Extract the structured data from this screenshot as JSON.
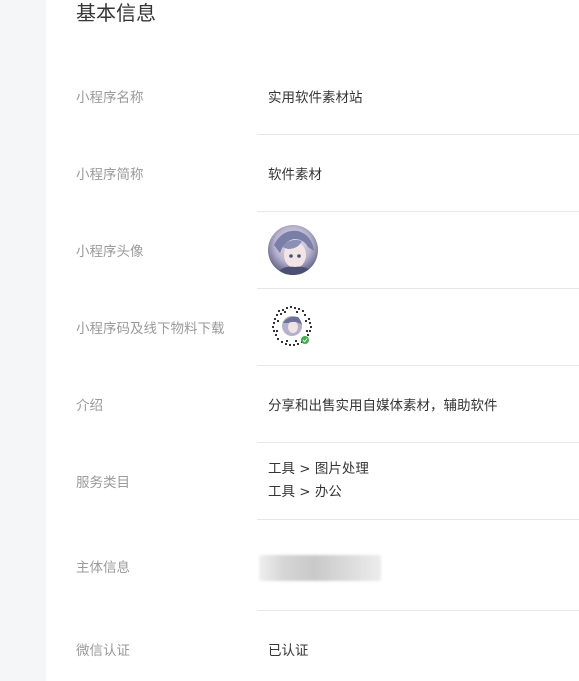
{
  "section": {
    "title": "基本信息"
  },
  "rows": {
    "name": {
      "label": "小程序名称",
      "value": "实用软件素材站"
    },
    "short_name": {
      "label": "小程序简称",
      "value": "软件素材"
    },
    "avatar": {
      "label": "小程序头像"
    },
    "qrcode": {
      "label": "小程序码及线下物料下载"
    },
    "intro": {
      "label": "介绍",
      "value": "分享和出售实用自媒体素材，辅助软件"
    },
    "category": {
      "label": "服务类目",
      "items": [
        "工具 > 图片处理",
        "工具 > 办公"
      ]
    },
    "entity": {
      "label": "主体信息"
    },
    "wechat_cert": {
      "label": "微信认证",
      "value": "已认证"
    }
  },
  "colors": {
    "label": "#9a9a9a",
    "value": "#353535",
    "divider": "#e7e7eb",
    "background": "#f5f6f7"
  }
}
